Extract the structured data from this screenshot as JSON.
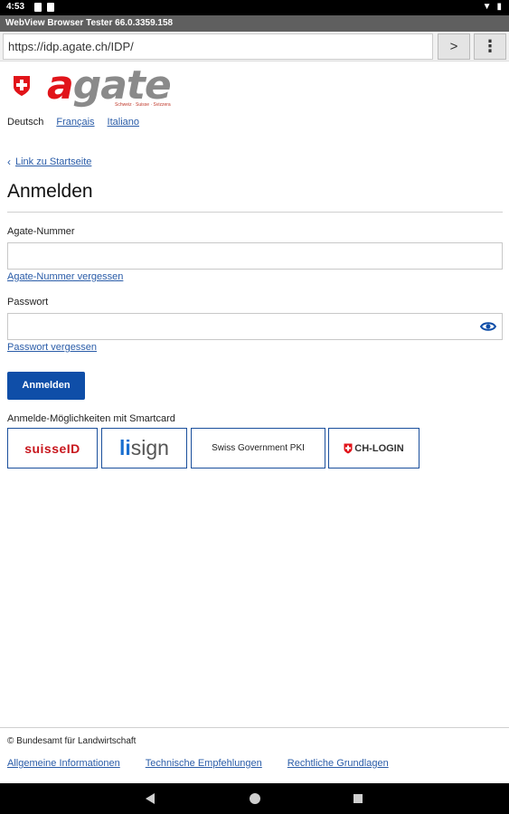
{
  "status_bar": {
    "time": "4:53"
  },
  "browser": {
    "app_title": "WebView Browser Tester 66.0.3359.158",
    "url": "https://idp.agate.ch/IDP/",
    "go_label": ">",
    "menu_label": "⋮"
  },
  "logo": {
    "prefix": "a",
    "rest": "gate",
    "tagline": "Schweiz · Suisse · Svizzera"
  },
  "languages": {
    "current": "Deutsch",
    "options": [
      "Français",
      "Italiano"
    ]
  },
  "back_link": "Link zu Startseite",
  "page_title": "Anmelden",
  "form": {
    "agate_label": "Agate-Nummer",
    "agate_forgot": "Agate-Nummer vergessen",
    "password_label": "Passwort",
    "password_forgot": "Passwort vergessen",
    "submit_label": "Anmelden"
  },
  "smartcard": {
    "heading": "Anmelde-Möglichkeiten mit Smartcard",
    "suisseid": "suisseID",
    "lisign_prefix": "li",
    "lisign_rest": "sign",
    "pki": "Swiss Government PKI",
    "chlogin": "CH-LOGIN"
  },
  "footer": {
    "copyright": "© Bundesamt für Landwirtschaft",
    "links": [
      "Allgemeine Informationen",
      "Technische Empfehlungen",
      "Rechtliche Grundlagen"
    ]
  },
  "colors": {
    "brand_red": "#e1141a",
    "link_blue": "#2a5ca8",
    "button_blue": "#0f4ea8"
  }
}
